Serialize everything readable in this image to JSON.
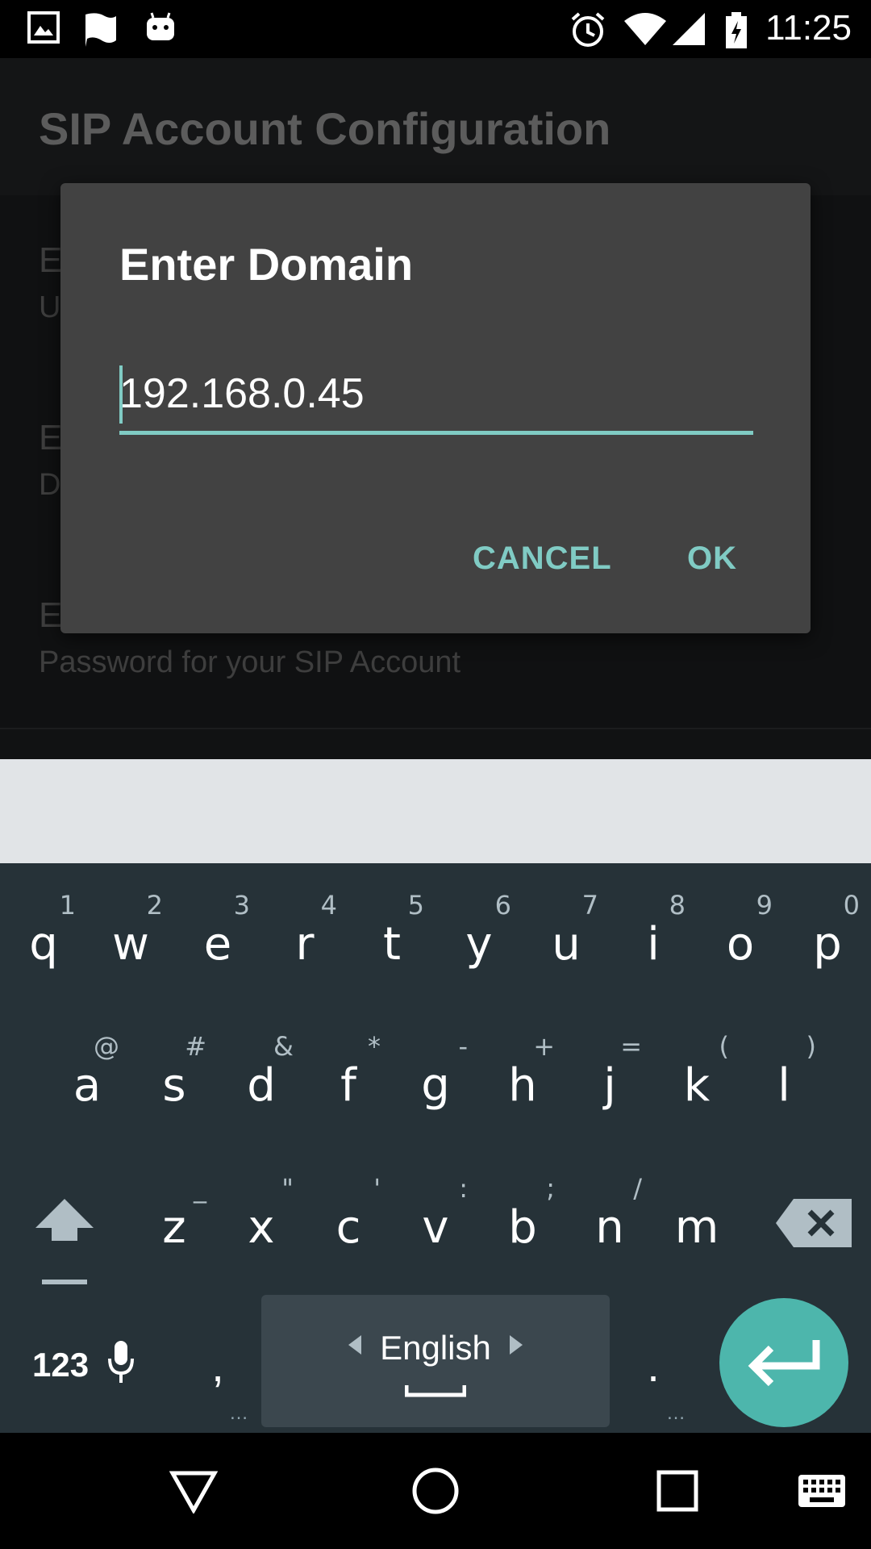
{
  "status_bar": {
    "time": "11:25",
    "icons": [
      "image-icon",
      "flag-icon",
      "android-icon",
      "alarm-icon",
      "wifi-icon",
      "signal-icon",
      "battery-charging-icon"
    ]
  },
  "app": {
    "title": "SIP Account Configuration",
    "prefs": [
      {
        "title": "E",
        "summary": "U"
      },
      {
        "title": "E",
        "summary": "D"
      },
      {
        "title": "E",
        "summary": "Password for your SIP Account"
      }
    ]
  },
  "dialog": {
    "title": "Enter Domain",
    "input_value": "192.168.0.45",
    "cancel_label": "CANCEL",
    "ok_label": "OK"
  },
  "keyboard": {
    "row1": [
      {
        "k": "q",
        "h": "1"
      },
      {
        "k": "w",
        "h": "2"
      },
      {
        "k": "e",
        "h": "3"
      },
      {
        "k": "r",
        "h": "4"
      },
      {
        "k": "t",
        "h": "5"
      },
      {
        "k": "y",
        "h": "6"
      },
      {
        "k": "u",
        "h": "7"
      },
      {
        "k": "i",
        "h": "8"
      },
      {
        "k": "o",
        "h": "9"
      },
      {
        "k": "p",
        "h": "0"
      }
    ],
    "row2": [
      {
        "k": "a",
        "h": "@"
      },
      {
        "k": "s",
        "h": "#"
      },
      {
        "k": "d",
        "h": "&"
      },
      {
        "k": "f",
        "h": "*"
      },
      {
        "k": "g",
        "h": "-"
      },
      {
        "k": "h",
        "h": "+"
      },
      {
        "k": "j",
        "h": "="
      },
      {
        "k": "k",
        "h": "("
      },
      {
        "k": "l",
        "h": ")"
      }
    ],
    "row3": [
      {
        "k": "z",
        "h": "_"
      },
      {
        "k": "x",
        "h": "\""
      },
      {
        "k": "c",
        "h": "'"
      },
      {
        "k": "v",
        "h": ":"
      },
      {
        "k": "b",
        "h": ";"
      },
      {
        "k": "n",
        "h": "/"
      },
      {
        "k": "m",
        "h": ""
      }
    ],
    "symbols_label": "123",
    "comma": ",",
    "period": ".",
    "language": "English",
    "accent_color": "#4db6ac"
  },
  "nav": {
    "icons": [
      "back-icon",
      "home-icon",
      "recents-icon",
      "keyboard-switch-icon"
    ]
  }
}
